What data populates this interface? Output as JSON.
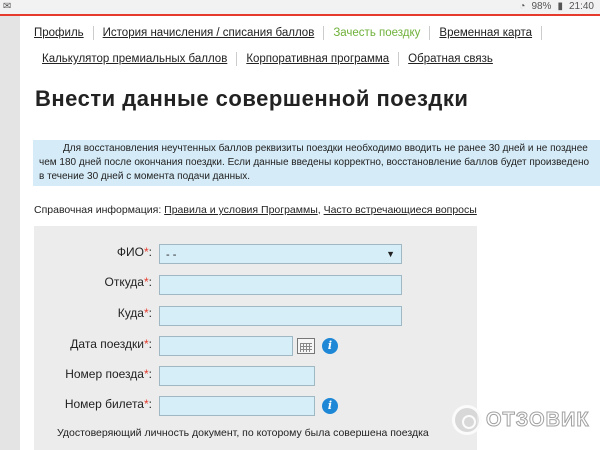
{
  "status_bar": {
    "battery": "98%",
    "time": "21:40"
  },
  "nav": {
    "row1": [
      {
        "label": "Профиль",
        "active": false
      },
      {
        "label": "История начисления / списания баллов",
        "active": false
      },
      {
        "label": "Зачесть поездку",
        "active": true
      },
      {
        "label": "Временная карта",
        "active": false
      }
    ],
    "row2": [
      {
        "label": "Калькулятор премиальных баллов"
      },
      {
        "label": "Корпоративная программа"
      },
      {
        "label": "Обратная связь"
      }
    ]
  },
  "page": {
    "title": "Внести данные совершенной поездки",
    "info": "Для восстановления неучтенных баллов реквизиты поездки необходимо вводить не ранее 30 дней и не позднее чем 180 дней после окончания поездки. Если данные введены корректно, восстановление баллов будет произведено в течение 30 дней с момента подачи данных."
  },
  "reference": {
    "prefix": "Справочная информация: ",
    "link1": "Правила и условия Программы",
    "separator": ", ",
    "link2": "Часто встречающиеся вопросы"
  },
  "form": {
    "required_mark": "*",
    "fio_label": "ФИО",
    "fio_value": "- -",
    "from_label": "Откуда",
    "to_label": "Куда",
    "date_label": "Дата поездки",
    "train_label": "Номер поезда",
    "ticket_label": "Номер билета",
    "doc_label": "Удостоверяющий личность документ, по которому была совершена поездка"
  },
  "watermark": {
    "text": "ОТЗОВИК"
  },
  "colors": {
    "accent_red": "#e53a2c",
    "active_green": "#6fb13a",
    "info_bg": "#d5ebf7",
    "field_bg": "#d5eef8",
    "info_icon": "#1e88d6"
  }
}
